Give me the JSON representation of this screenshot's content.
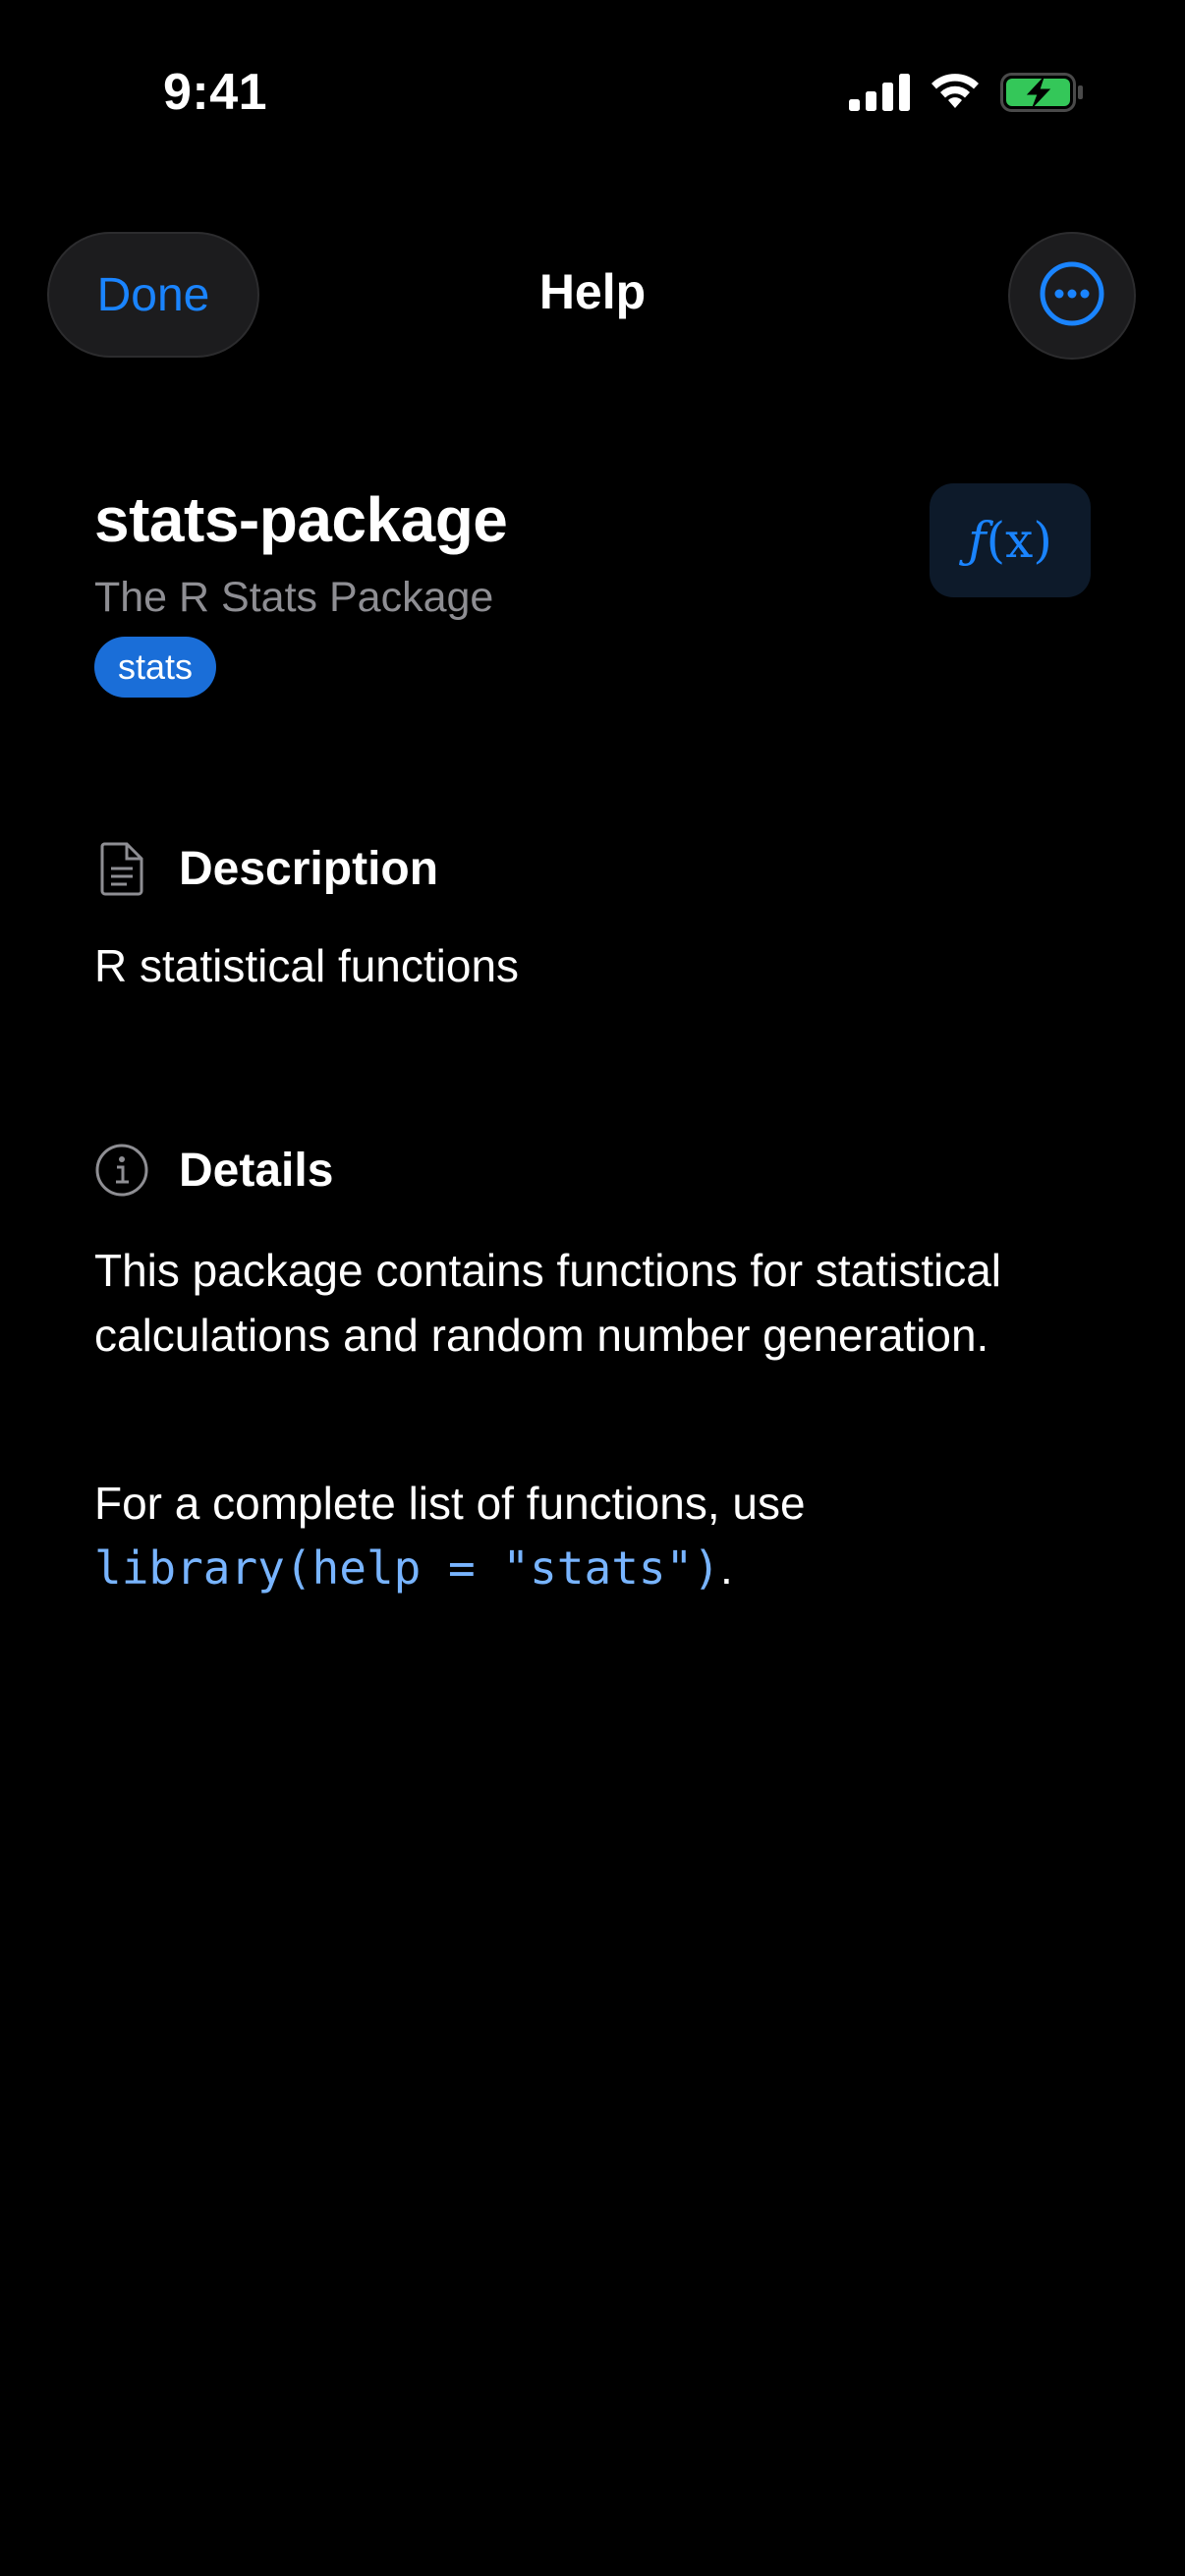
{
  "status_bar": {
    "time": "9:41"
  },
  "nav": {
    "done_label": "Done",
    "title": "Help",
    "more_icon": "ellipsis-circle-icon"
  },
  "package": {
    "name": "stats-package",
    "subtitle": "The R Stats Package",
    "tag": "stats",
    "fx_label_f": "ƒ",
    "fx_label_x": "(x)"
  },
  "description": {
    "heading": "Description",
    "text": "R statistical functions",
    "icon": "document-icon"
  },
  "details": {
    "heading": "Details",
    "icon": "info-circle-icon",
    "paragraph1": "This package contains functions for statistical calculations and random number generation.",
    "paragraph2_prefix": "For a complete list of functions, use",
    "paragraph2_code": "library(help = \"stats\")",
    "paragraph2_suffix": "."
  },
  "colors": {
    "accent": "#1a84ff",
    "tag_bg": "#1a6ed8",
    "battery_green": "#34c759",
    "secondary_text": "#8e8e93"
  }
}
